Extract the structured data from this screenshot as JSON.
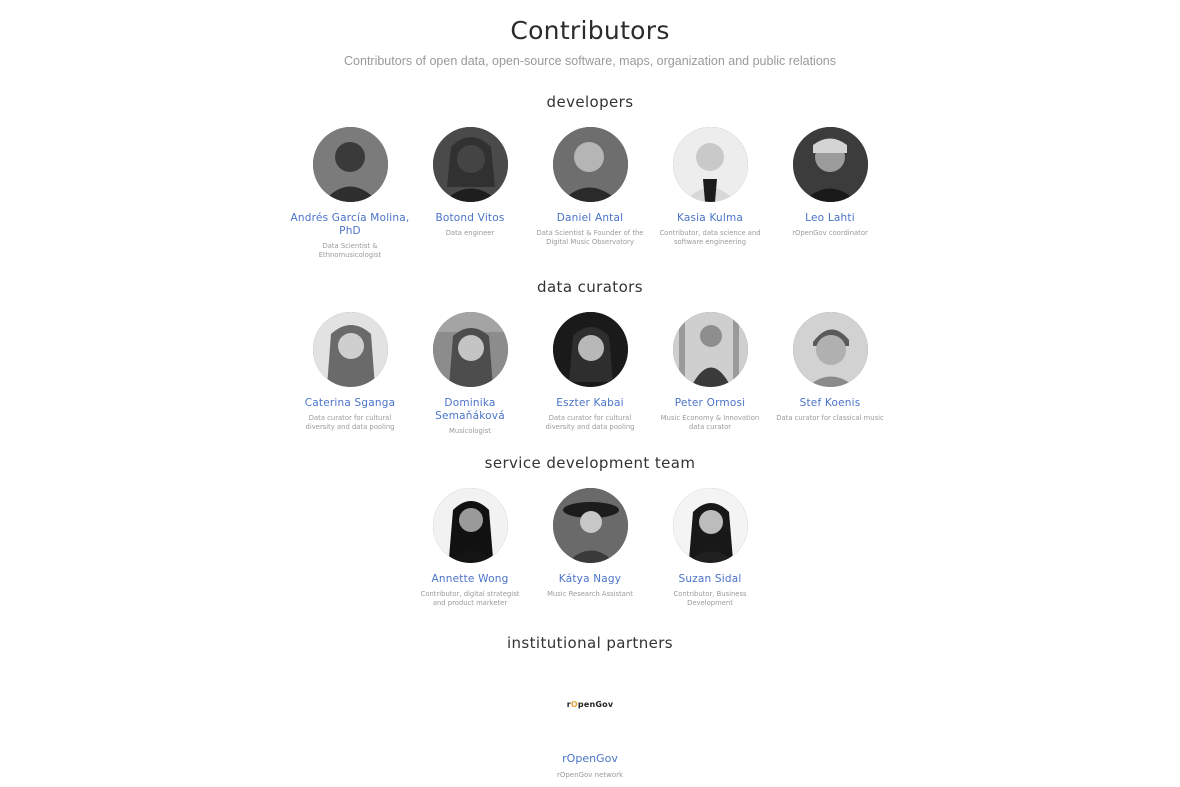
{
  "page": {
    "title": "Contributors",
    "subtitle": "Contributors of open data, open-source software, maps, organization and public relations"
  },
  "sections": [
    {
      "title": "developers",
      "people": [
        {
          "name": "Andrés García Molina, PhD",
          "role": "Data Scientist & Ethnomusicologist"
        },
        {
          "name": "Botond Vitos",
          "role": "Data engineer"
        },
        {
          "name": "Daniel Antal",
          "role": "Data Scientist & Founder of the Digital Music Observatory"
        },
        {
          "name": "Kasia Kulma",
          "role": "Contributor, data science and software engineering"
        },
        {
          "name": "Leo Lahti",
          "role": "rOpenGov coordinator"
        }
      ]
    },
    {
      "title": "data curators",
      "people": [
        {
          "name": "Caterina Sganga",
          "role": "Data curator for cultural diversity and data pooling"
        },
        {
          "name": "Dominika Semaňáková",
          "role": "Musicologist"
        },
        {
          "name": "Eszter Kabai",
          "role": "Data curator for cultural diversity and data pooling"
        },
        {
          "name": "Peter Ormosi",
          "role": "Music Economy & Innovation data curator"
        },
        {
          "name": "Stef Koenis",
          "role": "Data curator for classical music"
        }
      ]
    },
    {
      "title": "service development team",
      "people": [
        {
          "name": "Annette Wong",
          "role": "Contributor, digital strategist and product marketer"
        },
        {
          "name": "Kátya Nagy",
          "role": "Music Research Assistant"
        },
        {
          "name": "Suzan Sidal",
          "role": "Contributor, Business Development"
        }
      ]
    },
    {
      "title": "institutional partners",
      "partners": [
        {
          "logo_prefix": "r",
          "logo_o": "O",
          "logo_suffix": "penGov",
          "name": "rOpenGov",
          "role": "rOpenGov network"
        }
      ]
    }
  ],
  "colors": {
    "link": "#4a73c8",
    "muted": "#9a9a9a",
    "heading": "#333333",
    "logo_accent": "#e8a33a"
  }
}
